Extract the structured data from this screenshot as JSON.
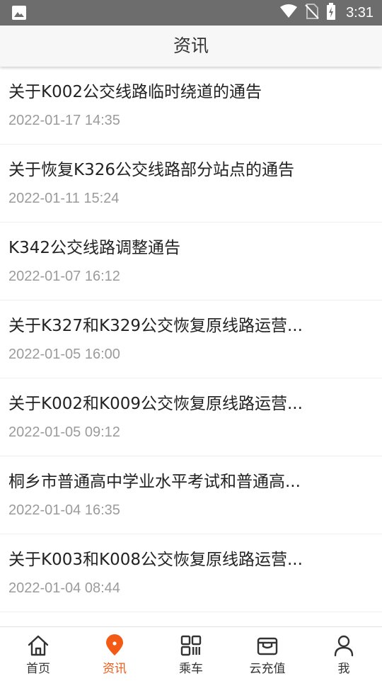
{
  "status_bar": {
    "time": "3:31"
  },
  "header": {
    "title": "资讯"
  },
  "news": [
    {
      "title": "关于K002公交线路临时绕道的通告",
      "date": "2022-01-17 14:35"
    },
    {
      "title": "关于恢复K326公交线路部分站点的通告",
      "date": "2022-01-11 15:24"
    },
    {
      "title": "K342公交线路调整通告",
      "date": "2022-01-07 16:12"
    },
    {
      "title": "关于K327和K329公交恢复原线路运营...",
      "date": "2022-01-05 16:00"
    },
    {
      "title": "关于K002和K009公交恢复原线路运营...",
      "date": "2022-01-05 09:12"
    },
    {
      "title": "桐乡市普通高中学业水平考试和普通高...",
      "date": "2022-01-04 16:35"
    },
    {
      "title": "关于K003和K008公交恢复原线路运营...",
      "date": "2022-01-04 08:44"
    }
  ],
  "tabs": [
    {
      "label": "首页",
      "icon": "home-icon"
    },
    {
      "label": "资讯",
      "icon": "location-pin-icon",
      "active": true
    },
    {
      "label": "乘车",
      "icon": "qr-code-icon"
    },
    {
      "label": "云充值",
      "icon": "wallet-icon"
    },
    {
      "label": "我",
      "icon": "person-icon"
    }
  ],
  "colors": {
    "accent": "#f25a16",
    "status_bar": "#6d6d6d",
    "header_bg": "#f7f7f7",
    "date_text": "#9b9b9b"
  }
}
